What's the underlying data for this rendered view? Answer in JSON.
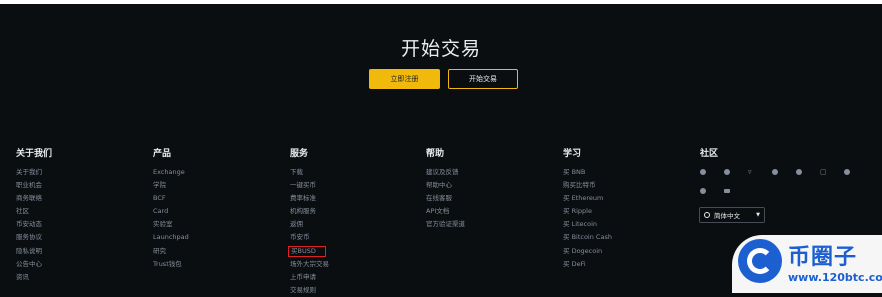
{
  "hero": {
    "title": "开始交易",
    "register_label": "立即注册",
    "trade_label": "开始交易"
  },
  "columns": [
    {
      "heading": "关于我们",
      "items": [
        "关于我们",
        "职业机会",
        "商务联络",
        "社区",
        "币安动态",
        "服务协议",
        "隐私说明",
        "公告中心",
        "资讯"
      ]
    },
    {
      "heading": "产品",
      "items": [
        "Exchange",
        "学院",
        "BCF",
        "Card",
        "实验室",
        "Launchpad",
        "研究",
        "Trust钱包"
      ]
    },
    {
      "heading": "服务",
      "items": [
        "下载",
        "一键买币",
        "费率标准",
        "机构服务",
        "返佣",
        "币安币",
        "买BUSD",
        "场外大宗交易",
        "上币申请",
        "交易规则"
      ]
    },
    {
      "heading": "帮助",
      "items": [
        "建议及反馈",
        "帮助中心",
        "在线客服",
        "API文档",
        "官方验证渠道"
      ]
    },
    {
      "heading": "学习",
      "items": [
        "买 BNB",
        "购买比特币",
        "买 Ethereum",
        "买 Ripple",
        "买 Litecoin",
        "买 Bitcoin Cash",
        "买 Dogecoin",
        "买 DeFi"
      ]
    }
  ],
  "community": {
    "heading": "社区",
    "icons_row1": [
      "telegram-icon",
      "facebook-icon",
      "twitter-icon",
      "reddit-icon",
      "weibo-icon",
      "instagram-icon",
      "vk-icon"
    ],
    "icons_row2": [
      "coinmarketcap-icon",
      "youtube-icon"
    ],
    "language": "简体中文"
  },
  "watermark": {
    "name": "币圈子",
    "url": "www.120btc.com"
  },
  "colors": {
    "background": "#0b0e11",
    "accent": "#f0b90b",
    "heading": "#eaecef",
    "link": "#848e9c"
  }
}
